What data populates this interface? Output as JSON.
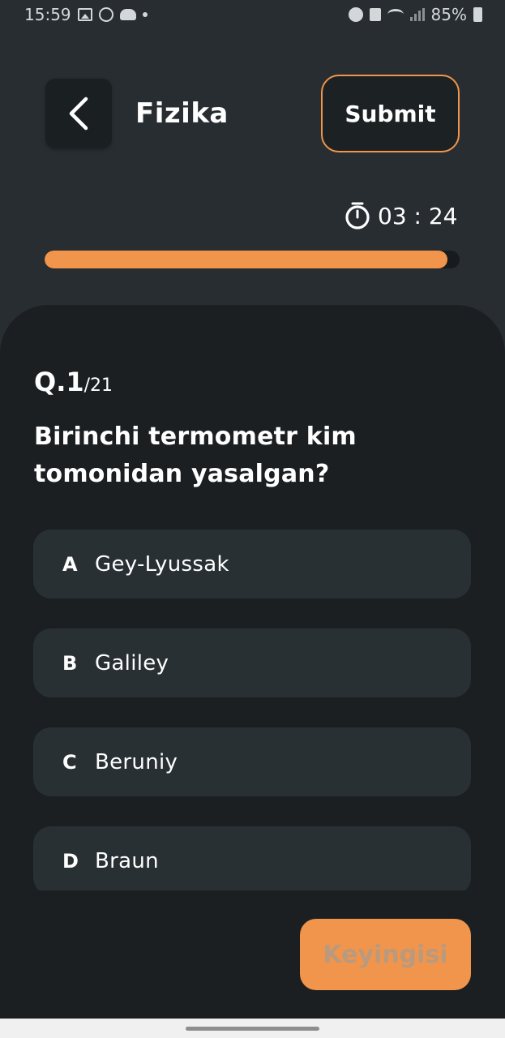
{
  "status_bar": {
    "time": "15:59",
    "battery": "85%",
    "icons": [
      "image-icon",
      "target-icon",
      "cloud-icon",
      "dot-icon",
      "alarm-icon",
      "lock-icon",
      "wifi-icon",
      "signal-icon",
      "battery-icon"
    ]
  },
  "header": {
    "back_icon": "chevron-left-icon",
    "title": "Fizika",
    "submit_label": "Submit"
  },
  "timer": {
    "icon": "stopwatch-icon",
    "value": "03 : 24"
  },
  "progress": {
    "fraction": 0.97,
    "color": "#f0954b"
  },
  "question": {
    "current": "Q.1",
    "total": "/21",
    "text": "Birinchi termometr kim tomonidan yasalgan?"
  },
  "options": [
    {
      "letter": "A",
      "text": "Gey-Lyussak"
    },
    {
      "letter": "B",
      "text": "Galiley"
    },
    {
      "letter": "C",
      "text": "Beruniy"
    },
    {
      "letter": "D",
      "text": "Braun"
    }
  ],
  "next_button": {
    "label": "Keyingisi",
    "color": "#f0954b"
  },
  "colors": {
    "background": "#272d31",
    "card": "#1b1f22",
    "option": "#293034",
    "accent": "#f0954b"
  }
}
